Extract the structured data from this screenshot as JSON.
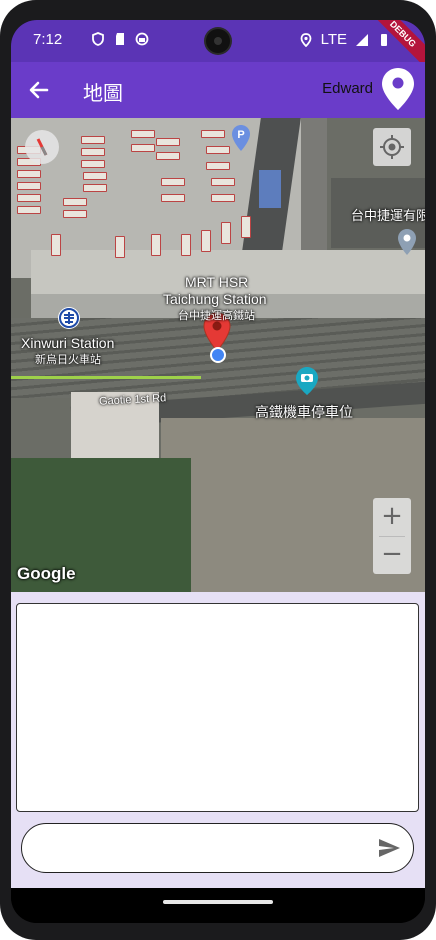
{
  "status": {
    "time": "7:12",
    "network": "LTE",
    "debug_banner": "DEBUG"
  },
  "appbar": {
    "title": "地圖",
    "user_name": "Edward"
  },
  "map": {
    "attribution": "Google",
    "labels": {
      "mrt_line1": "MRT HSR",
      "mrt_line2": "Taichung Station",
      "mrt_line3": "台中捷運高鐵站",
      "xinwuri_en": "Xinwuri Station",
      "xinwuri_zh": "新烏日火車站",
      "road": "Gaotie 1st Rd",
      "parking": "高鐵機車停車位",
      "metro_company": "台中捷運有限"
    },
    "zoom_in": "+",
    "zoom_out": "−"
  },
  "chat": {
    "message_text": "",
    "input_value": "",
    "input_placeholder": ""
  },
  "colors": {
    "statusbar": "#5b34b5",
    "appbar": "#6a3cc9",
    "panel": "#e6e0f5",
    "marker": "#e53935"
  }
}
